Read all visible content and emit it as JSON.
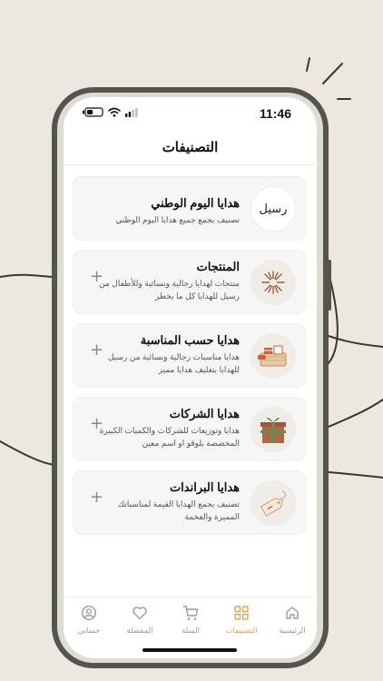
{
  "status_bar": {
    "time": "11:46"
  },
  "header": {
    "title": "التصنيفات"
  },
  "categories": [
    {
      "title": "هدايا اليوم الوطني",
      "description": "تصنيف يجمع جميع هدايا اليوم الوطني",
      "logo_text": "رسيل",
      "icon": "rseel-logo-icon",
      "expandable": false
    },
    {
      "title": "المنتجات",
      "description": "منتجات لهدايا رجالية ونسائية وللأطفال من رسيل للهدايا كل ما يخطر",
      "icon": "sparkle-icon",
      "expandable": true
    },
    {
      "title": "هدايا حسب المناسبة",
      "description": "هدايا مناسبات رجالية ونسائية من رسيل للهدايا بتغليف هدايا مميز",
      "icon": "gift-basket-icon",
      "expandable": true
    },
    {
      "title": "هدايا الشركات",
      "description": "هدايا وتوزيعات للشركات والكميات الكبيرة المخصصة بلوقو او اسم معين",
      "icon": "gift-box-icon",
      "expandable": true
    },
    {
      "title": "هدايا البراندات",
      "description": "تصنيف يجمع الهدايا القيمة لمناسباتك المميزة والفخمة",
      "icon": "price-tag-icon",
      "expandable": true
    }
  ],
  "bottom_nav": [
    {
      "label": "الرئيسية",
      "icon": "home-icon",
      "active": false
    },
    {
      "label": "التصنيفات",
      "icon": "grid-icon",
      "active": true
    },
    {
      "label": "السلة",
      "icon": "cart-icon",
      "active": false
    },
    {
      "label": "المفضلة",
      "icon": "heart-icon",
      "active": false
    },
    {
      "label": "حسابي",
      "icon": "user-icon",
      "active": false
    }
  ],
  "colors": {
    "accent": "#d8a64d",
    "card_bg": "#f6f6f6",
    "page_bg": "#ece7e0",
    "phone_frame": "#56544e"
  }
}
